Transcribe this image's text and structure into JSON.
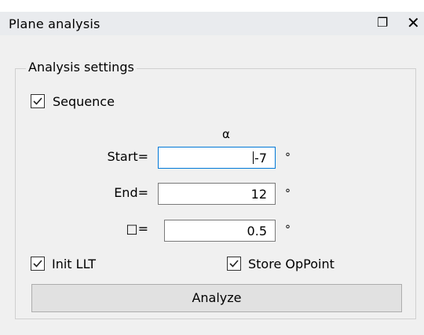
{
  "window": {
    "title": "Plane analysis",
    "float_icon": "float-icon",
    "close_icon": "close-icon"
  },
  "settings": {
    "group_title": "Analysis settings",
    "sequence": {
      "label": "Sequence",
      "checked": true
    },
    "column_header": "α",
    "fields": [
      {
        "label": "Start=",
        "value": "-7",
        "unit": "°",
        "focused": true
      },
      {
        "label": "End=",
        "value": "12",
        "unit": "°"
      },
      {
        "label": "□=",
        "value": "0.5",
        "unit": "°"
      }
    ],
    "init_llt": {
      "label": "Init LLT",
      "checked": true
    },
    "store_oppoint": {
      "label": "Store OpPoint",
      "checked": true
    },
    "analyze_label": "Analyze"
  },
  "colors": {
    "panel_bg": "#f0f0f0",
    "focus_border": "#0078d7",
    "button_bg": "#e1e1e1"
  }
}
